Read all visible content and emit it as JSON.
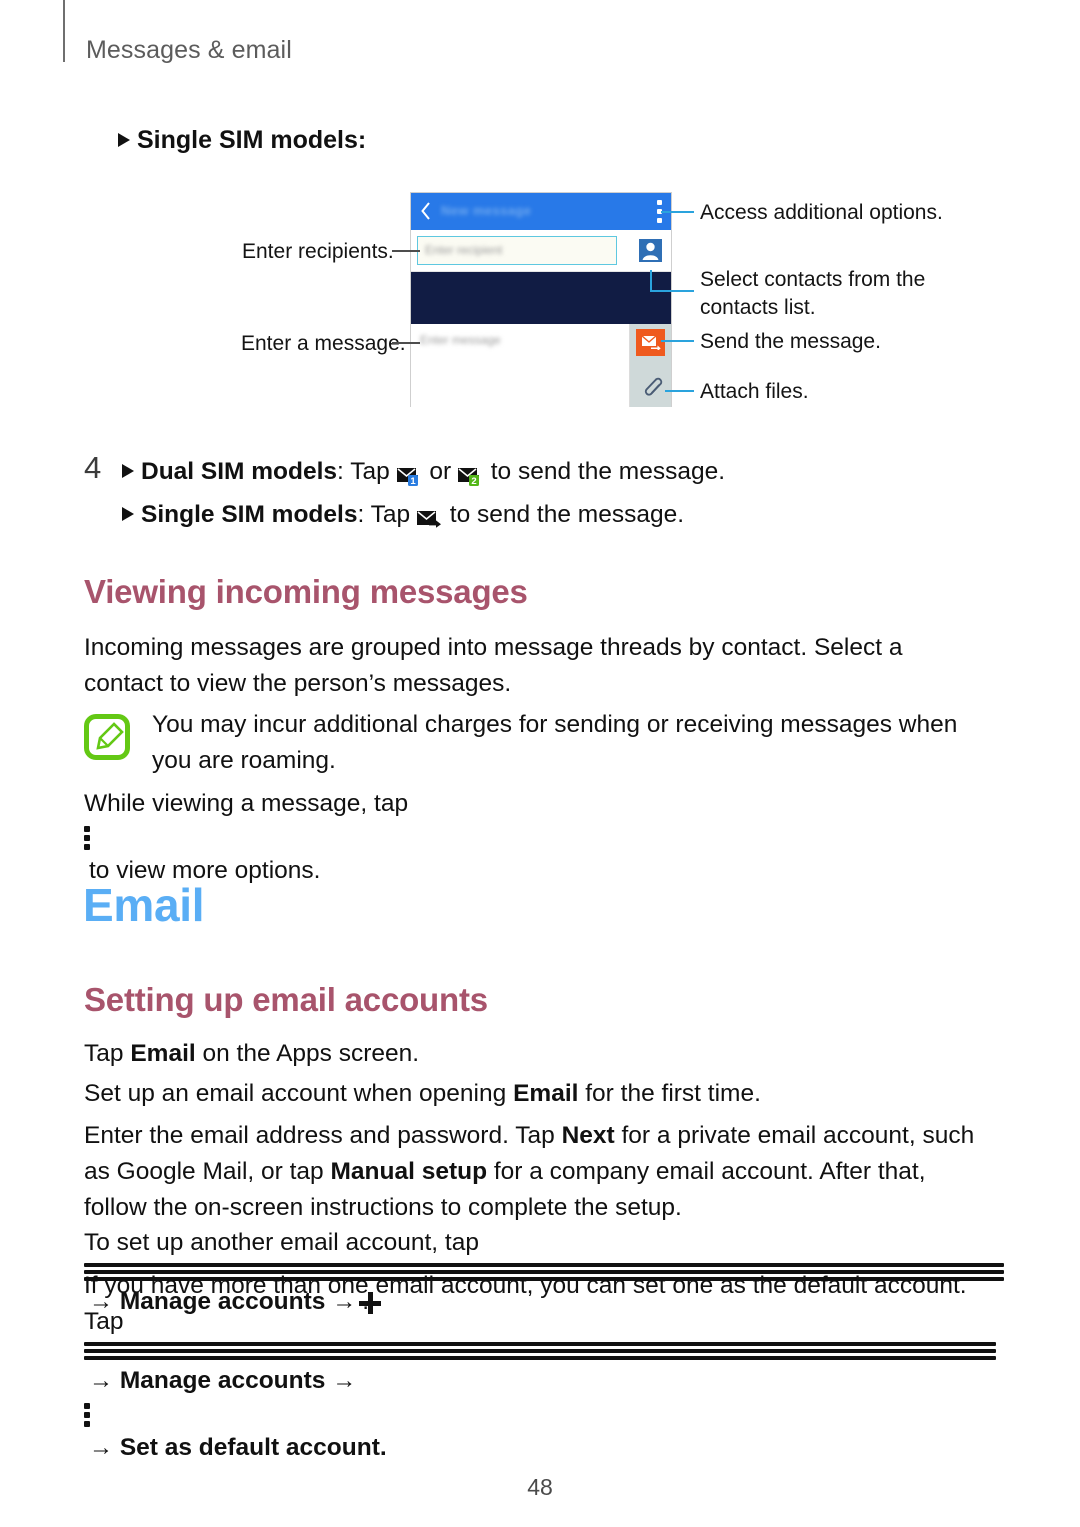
{
  "header": {
    "chapter_title": "Messages & email"
  },
  "single_sim_label": {
    "bullet": "triangle-right",
    "text": "Single SIM models:"
  },
  "phone_mock": {
    "statusbar_title": "New message",
    "back_icon": "chevron-left-icon",
    "more_icon": "kebab-menu-icon",
    "recipient_placeholder": "Enter recipient",
    "contacts_icon": "contact-person-icon",
    "message_placeholder": "Enter message",
    "send_icon": "send-message-icon",
    "attach_icon": "paperclip-icon",
    "colors": {
      "statusbar": "#2879e8",
      "thread_area": "#111c44",
      "send_button": "#ef5a1e",
      "side_panel": "#cfd9d9",
      "field_border": "#5ec8e0"
    }
  },
  "callouts": {
    "left": [
      {
        "text": "Enter recipients."
      },
      {
        "text": "Enter a message."
      }
    ],
    "right": [
      {
        "text": "Access additional options."
      },
      {
        "text": "Select contacts from the\ncontacts list."
      },
      {
        "text": "Send the message."
      },
      {
        "text": "Attach files."
      }
    ]
  },
  "step4": {
    "number": "4",
    "dual_label": "Dual SIM models",
    "dual_text_a": ": Tap ",
    "dual_text_b": " or ",
    "dual_text_c": " to send the message.",
    "single_label": "Single SIM models",
    "single_text_a": ": Tap ",
    "single_text_b": " to send the message.",
    "icon_sim1": "send-message-sim1-icon",
    "icon_sim2": "send-message-sim2-icon",
    "icon_send": "send-message-icon",
    "sim1_color": "#2a7de1",
    "sim2_color": "#54b719"
  },
  "viewing_section": {
    "heading": "Viewing incoming messages",
    "paragraph": "Incoming messages are grouped into message threads by contact. Select a contact to view the person’s messages.",
    "note_icon": "note-pen-icon",
    "note_text": "You may incur additional charges for sending or receiving messages when you are roaming.",
    "more_options_a": "While viewing a message, tap ",
    "more_options_icon": "kebab-menu-icon",
    "more_options_b": " to view more options."
  },
  "email_section": {
    "heading": "Email",
    "subheading": "Setting up email accounts",
    "p1_a": "Tap ",
    "p1_bold": "Email",
    "p1_b": " on the Apps screen.",
    "p2_a": "Set up an email account when opening ",
    "p2_bold": "Email",
    "p2_b": " for the first time.",
    "p3_a": "Enter the email address and password. Tap ",
    "p3_bold1": "Next",
    "p3_b": " for a private email account, such as Google Mail, or tap ",
    "p3_bold2": "Manual setup",
    "p3_c": " for a company email account. After that, follow the on-screen instructions to complete the setup.",
    "p4_a": "To set up another email account, tap ",
    "p4_icon1": "hamburger-menu-icon",
    "p4_arrow1": "→",
    "p4_bold": "Manage accounts",
    "p4_arrow2": "→",
    "p4_icon2": "plus-icon",
    "p4_end": ".",
    "p5_a": "If you have more than one email account, you can set one as the default account. Tap ",
    "p5_icon1": "hamburger-menu-icon",
    "p5_arrow1": "→",
    "p5_bold1": "Manage accounts",
    "p5_arrow2": "→",
    "p5_icon2": "kebab-menu-icon",
    "p5_arrow3": "→",
    "p5_bold2": "Set as default account",
    "p5_end": "."
  },
  "footer": {
    "page_number": "48"
  },
  "theme": {
    "heading_blue": "#5aaef5",
    "heading_rose": "#a8546c",
    "header_gray": "#5c5c5c",
    "note_green": "#63c814"
  }
}
